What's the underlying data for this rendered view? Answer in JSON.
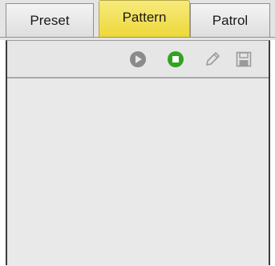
{
  "tabs": [
    {
      "label": "Preset",
      "active": false
    },
    {
      "label": "Pattern",
      "active": true
    },
    {
      "label": "Patrol",
      "active": false
    }
  ],
  "toolbar": {
    "buttons": [
      {
        "icon": "play-icon",
        "enabled": false
      },
      {
        "icon": "stop-icon",
        "enabled": true
      },
      {
        "icon": "pencil-icon",
        "enabled": false
      },
      {
        "icon": "save-icon",
        "enabled": false
      }
    ]
  },
  "colors": {
    "active_tab": "#f2e05a",
    "stop_green": "#2fa51f",
    "disabled_gray": "#8a8a8a",
    "panel_bg": "#e9e9e9"
  }
}
